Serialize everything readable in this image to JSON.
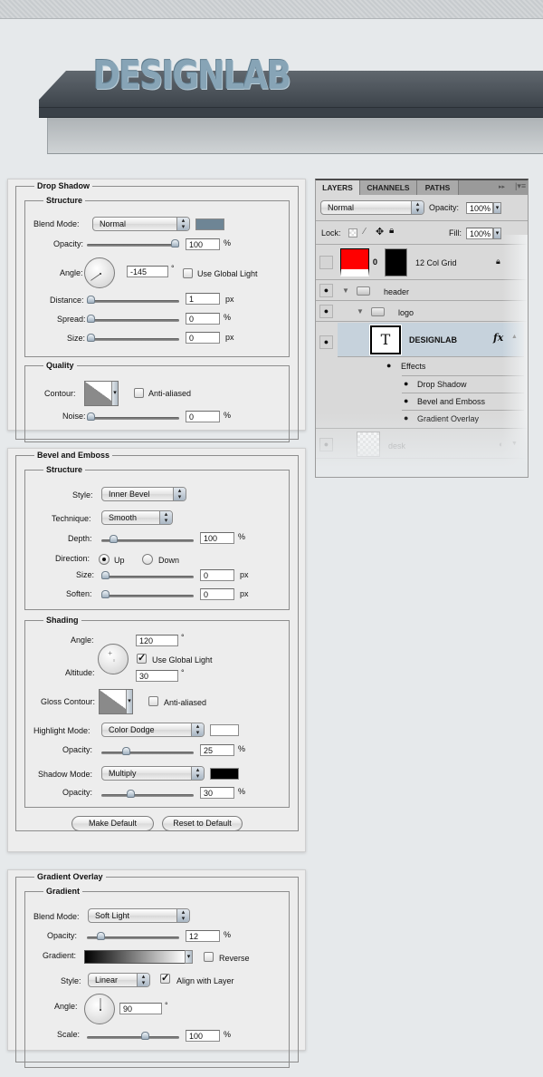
{
  "header": {
    "logo_text": "DESIGNLAB"
  },
  "drop_shadow": {
    "title": "Drop Shadow",
    "structure": {
      "title": "Structure",
      "blend_mode_label": "Blend Mode:",
      "blend_mode_value": "Normal",
      "blend_color": "#6e8595",
      "opacity_label": "Opacity:",
      "opacity_value": "100",
      "opacity_unit": "%",
      "opacity_slider": 1.0,
      "angle_label": "Angle:",
      "angle_value": "-145",
      "degree_symbol": "°",
      "use_global_light_label": "Use Global Light",
      "use_global_light_checked": false,
      "distance_label": "Distance:",
      "distance_value": "1",
      "distance_unit": "px",
      "distance_slider": 0.0,
      "spread_label": "Spread:",
      "spread_value": "0",
      "spread_unit": "%",
      "spread_slider": 0.0,
      "size_label": "Size:",
      "size_value": "0",
      "size_unit": "px",
      "size_slider": 0.0
    },
    "quality": {
      "title": "Quality",
      "contour_label": "Contour:",
      "anti_aliased_label": "Anti-aliased",
      "anti_aliased_checked": false,
      "noise_label": "Noise:",
      "noise_value": "0",
      "noise_unit": "%",
      "noise_slider": 0.0
    }
  },
  "bevel_emboss": {
    "title": "Bevel and Emboss",
    "structure": {
      "title": "Structure",
      "style_label": "Style:",
      "style_value": "Inner Bevel",
      "technique_label": "Technique:",
      "technique_value": "Smooth",
      "depth_label": "Depth:",
      "depth_value": "100",
      "depth_unit": "%",
      "depth_slider": 0.1,
      "direction_label": "Direction:",
      "direction_up_label": "Up",
      "direction_down_label": "Down",
      "direction_selected": "Up",
      "size_label": "Size:",
      "size_value": "0",
      "size_unit": "px",
      "size_slider": 0.0,
      "soften_label": "Soften:",
      "soften_value": "0",
      "soften_unit": "px",
      "soften_slider": 0.0
    },
    "shading": {
      "title": "Shading",
      "angle_label": "Angle:",
      "angle_value": "120",
      "degree_symbol": "°",
      "use_global_light_label": "Use Global Light",
      "use_global_light_checked": true,
      "altitude_label": "Altitude:",
      "altitude_value": "30",
      "gloss_contour_label": "Gloss Contour:",
      "anti_aliased_label": "Anti-aliased",
      "anti_aliased_checked": false,
      "highlight_mode_label": "Highlight Mode:",
      "highlight_mode_value": "Color Dodge",
      "highlight_color": "#ffffff",
      "highlight_opacity_label": "Opacity:",
      "highlight_opacity_value": "25",
      "highlight_opacity_unit": "%",
      "highlight_opacity_slider": 0.25,
      "shadow_mode_label": "Shadow Mode:",
      "shadow_mode_value": "Multiply",
      "shadow_color": "#000000",
      "shadow_opacity_label": "Opacity:",
      "shadow_opacity_value": "30",
      "shadow_opacity_unit": "%",
      "shadow_opacity_slider": 0.3
    },
    "make_default_label": "Make Default",
    "reset_default_label": "Reset to Default"
  },
  "gradient_overlay": {
    "title": "Gradient Overlay",
    "gradient": {
      "title": "Gradient",
      "blend_mode_label": "Blend Mode:",
      "blend_mode_value": "Soft Light",
      "opacity_label": "Opacity:",
      "opacity_value": "12",
      "opacity_unit": "%",
      "opacity_slider": 0.12,
      "gradient_label": "Gradient:",
      "gradient_from": "#000000",
      "gradient_to": "#ffffff",
      "reverse_label": "Reverse",
      "reverse_checked": false,
      "style_label": "Style:",
      "style_value": "Linear",
      "align_label": "Align with Layer",
      "align_checked": true,
      "angle_label": "Angle:",
      "angle_value": "90",
      "degree_symbol": "°",
      "scale_label": "Scale:",
      "scale_value": "100",
      "scale_unit": "%",
      "scale_slider": 0.65
    }
  },
  "layers_panel": {
    "tabs": [
      {
        "label": "LAYERS",
        "active": true
      },
      {
        "label": "CHANNELS",
        "active": false
      },
      {
        "label": "PATHS",
        "active": false
      }
    ],
    "blend_mode": "Normal",
    "opacity_label": "Opacity:",
    "opacity_value": "100%",
    "lock_label": "Lock:",
    "fill_label": "Fill:",
    "fill_value": "100%",
    "layers": [
      {
        "name": "12 Col Grid",
        "visible": false,
        "locked": true,
        "type": "fill-with-mask",
        "fill_color": "#ff0000"
      },
      {
        "name": "header",
        "visible": true,
        "type": "group",
        "expanded": true
      },
      {
        "name": "logo",
        "visible": true,
        "type": "group",
        "expanded": true
      },
      {
        "name": "DESIGNLAB",
        "visible": true,
        "type": "text",
        "selected": true,
        "fx_label": "fx",
        "thumb_glyph": "T"
      },
      {
        "name": "desk",
        "visible": true,
        "type": "smart-object"
      }
    ],
    "effects": {
      "label": "Effects",
      "items": [
        "Drop Shadow",
        "Bevel and Emboss",
        "Gradient Overlay"
      ]
    }
  }
}
